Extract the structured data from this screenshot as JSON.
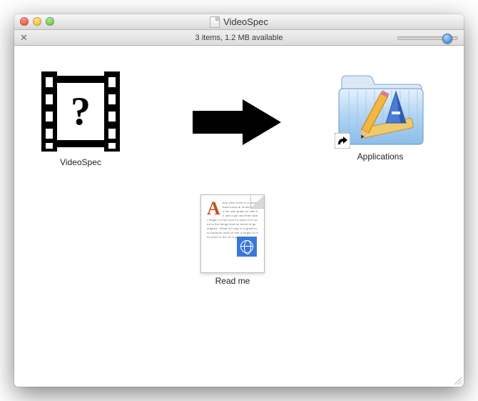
{
  "window": {
    "title": "VideoSpec"
  },
  "toolbar": {
    "status": "3 items, 1.2 MB available"
  },
  "items": {
    "app": {
      "label": "VideoSpec"
    },
    "folder": {
      "label": "Applications"
    },
    "readme": {
      "label": "Read me"
    }
  }
}
